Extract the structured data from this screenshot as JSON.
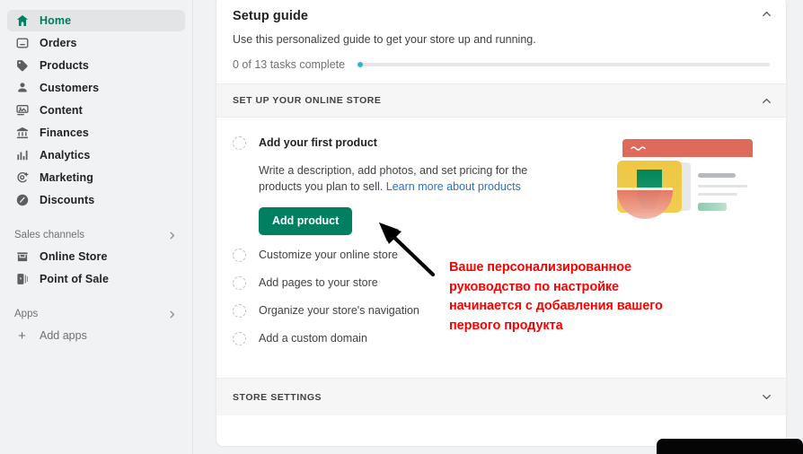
{
  "sidebar": {
    "items": [
      {
        "label": "Home",
        "icon": "home-icon",
        "active": true
      },
      {
        "label": "Orders",
        "icon": "orders-icon",
        "active": false
      },
      {
        "label": "Products",
        "icon": "products-tag-icon",
        "active": false
      },
      {
        "label": "Customers",
        "icon": "customers-person-icon",
        "active": false
      },
      {
        "label": "Content",
        "icon": "content-media-icon",
        "active": false
      },
      {
        "label": "Finances",
        "icon": "finances-bank-icon",
        "active": false
      },
      {
        "label": "Analytics",
        "icon": "analytics-bar-chart-icon",
        "active": false
      },
      {
        "label": "Marketing",
        "icon": "marketing-target-icon",
        "active": false
      },
      {
        "label": "Discounts",
        "icon": "discounts-percent-icon",
        "active": false
      }
    ],
    "sales_channels": {
      "label": "Sales channels",
      "items": [
        {
          "label": "Online Store",
          "icon": "store-icon"
        },
        {
          "label": "Point of Sale",
          "icon": "point-of-sale-icon"
        }
      ]
    },
    "apps": {
      "label": "Apps",
      "add_label": "Add apps"
    }
  },
  "card": {
    "title": "Setup guide",
    "subtitle": "Use this personalized guide to get your store up and running.",
    "progress_label": "0 of 13 tasks complete",
    "progress_percent": 0,
    "tasks_total": 13,
    "tasks_complete": 0,
    "section_online_store": "SET UP YOUR ONLINE STORE",
    "section_store_settings": "STORE SETTINGS",
    "tasks": [
      {
        "title": "Add your first product",
        "description": "Write a description, add photos, and set pricing for the products you plan to sell.",
        "link": "Learn more about products",
        "button": "Add product"
      },
      {
        "title": "Customize your online store"
      },
      {
        "title": "Add pages to your store"
      },
      {
        "title": "Organize your store's navigation"
      },
      {
        "title": "Add a custom domain"
      }
    ]
  },
  "annotation": {
    "text": "Ваше персонализированное руководство по настройке начинается с добавления вашего первого продукта",
    "color": "#fa0000"
  },
  "colors": {
    "accent_green": "#008060",
    "link_blue": "#2c6ecb",
    "progress_dot": "#2eb5c8",
    "sidebar_bg": "#f1f2f4",
    "annotation_red": "#fa0000"
  }
}
